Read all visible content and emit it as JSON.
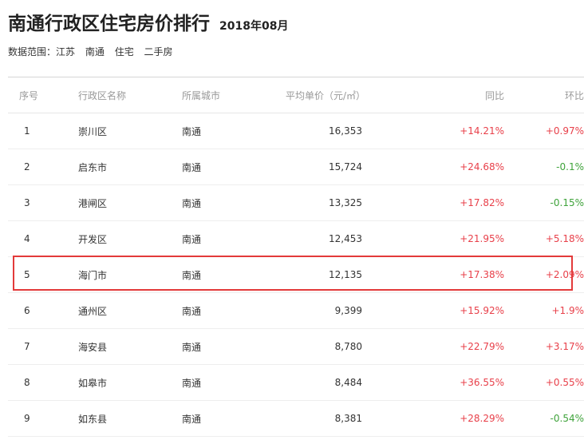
{
  "header": {
    "title": "南通行政区住宅房价排行",
    "date": "2018年08月"
  },
  "scope": {
    "label": "数据范围：",
    "items": [
      "江苏",
      "南通",
      "住宅",
      "二手房"
    ]
  },
  "table": {
    "columns": {
      "rank": "序号",
      "name": "行政区名称",
      "city": "所属城市",
      "price": "平均单价（元/㎡）",
      "yoy": "同比",
      "mom": "环比"
    },
    "rows": [
      {
        "rank": "1",
        "name": "崇川区",
        "city": "南通",
        "price": "16,353",
        "yoy": "+14.21%",
        "mom": "+0.97%",
        "yoy_dir": "up",
        "mom_dir": "up"
      },
      {
        "rank": "2",
        "name": "启东市",
        "city": "南通",
        "price": "15,724",
        "yoy": "+24.68%",
        "mom": "-0.1%",
        "yoy_dir": "up",
        "mom_dir": "down"
      },
      {
        "rank": "3",
        "name": "港闸区",
        "city": "南通",
        "price": "13,325",
        "yoy": "+17.82%",
        "mom": "-0.15%",
        "yoy_dir": "up",
        "mom_dir": "down"
      },
      {
        "rank": "4",
        "name": "开发区",
        "city": "南通",
        "price": "12,453",
        "yoy": "+21.95%",
        "mom": "+5.18%",
        "yoy_dir": "up",
        "mom_dir": "up"
      },
      {
        "rank": "5",
        "name": "海门市",
        "city": "南通",
        "price": "12,135",
        "yoy": "+17.38%",
        "mom": "+2.09%",
        "yoy_dir": "up",
        "mom_dir": "up"
      },
      {
        "rank": "6",
        "name": "通州区",
        "city": "南通",
        "price": "9,399",
        "yoy": "+15.92%",
        "mom": "+1.9%",
        "yoy_dir": "up",
        "mom_dir": "up"
      },
      {
        "rank": "7",
        "name": "海安县",
        "city": "南通",
        "price": "8,780",
        "yoy": "+22.79%",
        "mom": "+3.17%",
        "yoy_dir": "up",
        "mom_dir": "up"
      },
      {
        "rank": "8",
        "name": "如皋市",
        "city": "南通",
        "price": "8,484",
        "yoy": "+36.55%",
        "mom": "+0.55%",
        "yoy_dir": "up",
        "mom_dir": "up"
      },
      {
        "rank": "9",
        "name": "如东县",
        "city": "南通",
        "price": "8,381",
        "yoy": "+28.29%",
        "mom": "-0.54%",
        "yoy_dir": "up",
        "mom_dir": "down"
      }
    ]
  },
  "highlight": {
    "row_rank": "5",
    "color": "#e33a3a"
  },
  "colors": {
    "up": "#e8404a",
    "down": "#3fa33b",
    "header_text": "#999999"
  }
}
